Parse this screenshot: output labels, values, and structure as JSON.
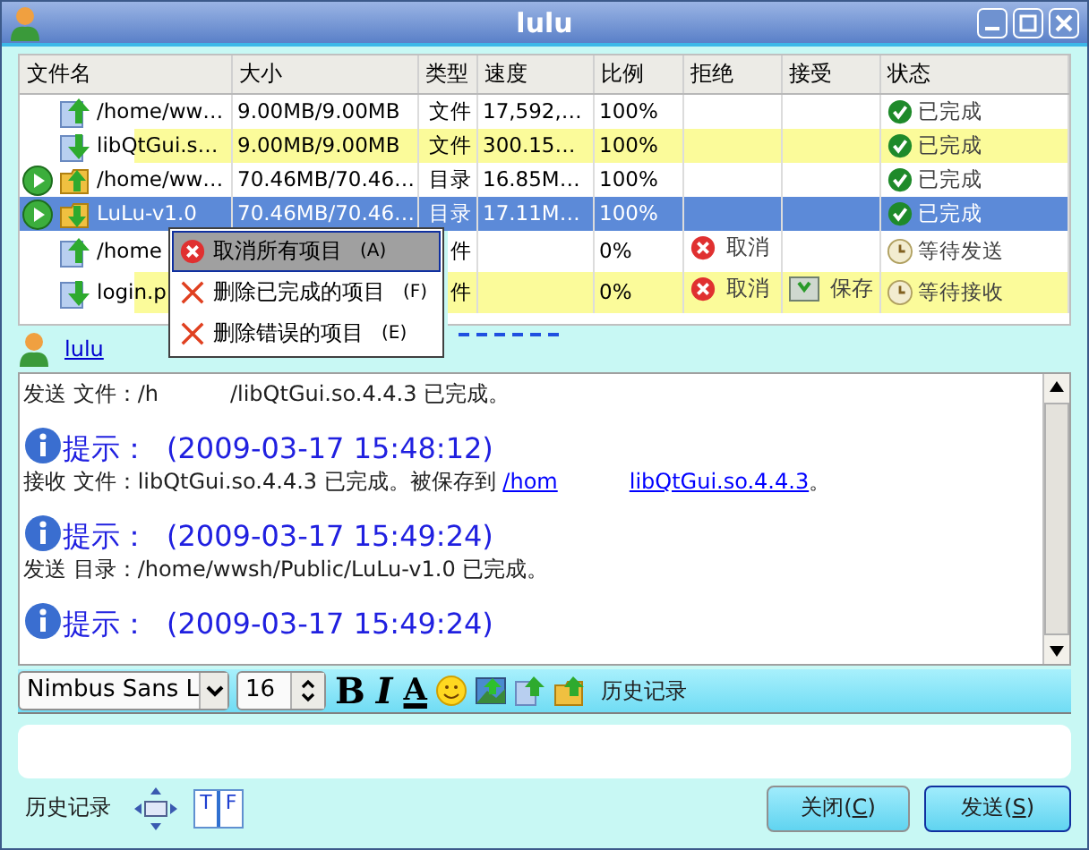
{
  "window": {
    "title": "lulu"
  },
  "table": {
    "columns": [
      "文件名",
      "大小",
      "类型",
      "速度",
      "比例",
      "拒绝",
      "接受",
      "状态"
    ],
    "rows": [
      {
        "name": "/home/ww…",
        "size": "9.00MB/9.00MB",
        "type": "文件",
        "speed": "17,592,…",
        "ratio": "100%",
        "incoming": false,
        "folder": false,
        "play_button": false,
        "reject": "",
        "accept": "",
        "status": "已完成",
        "done": true,
        "selected": false
      },
      {
        "name": "libQtGui.s…",
        "size": "9.00MB/9.00MB",
        "type": "文件",
        "speed": "300.15…",
        "ratio": "100%",
        "incoming": true,
        "folder": false,
        "play_button": false,
        "reject": "",
        "accept": "",
        "status": "已完成",
        "done": true,
        "selected": false
      },
      {
        "name": "/home/ww…",
        "size": "70.46MB/70.46…",
        "type": "目录",
        "speed": "16.85M…",
        "ratio": "100%",
        "incoming": false,
        "folder": true,
        "play_button": true,
        "reject": "",
        "accept": "",
        "status": "已完成",
        "done": true,
        "selected": false
      },
      {
        "name": "LuLu-v1.0",
        "size": "70.46MB/70.46…",
        "type": "目录",
        "speed": "17.11M…",
        "ratio": "100%",
        "incoming": true,
        "folder": true,
        "play_button": true,
        "reject": "",
        "accept": "",
        "status": "已完成",
        "done": true,
        "selected": true
      },
      {
        "name": "/home",
        "size": "",
        "type": "件",
        "speed": "",
        "ratio": "0%",
        "incoming": false,
        "folder": false,
        "play_button": false,
        "reject": "取消",
        "accept": "",
        "status": "等待发送",
        "done": false,
        "selected": false
      },
      {
        "name": "login.p",
        "size": "",
        "type": "件",
        "speed": "",
        "ratio": "0%",
        "incoming": true,
        "folder": false,
        "play_button": false,
        "reject": "取消",
        "accept": "保存",
        "status": "等待接收",
        "done": false,
        "selected": false
      }
    ]
  },
  "context_menu": {
    "items": [
      {
        "label": "取消所有项目",
        "shortcut": "(A)",
        "kind": "cancel",
        "selected": true
      },
      {
        "label": "删除已完成的项目",
        "shortcut": "(F)",
        "kind": "delete",
        "selected": false
      },
      {
        "label": "删除错误的项目",
        "shortcut": "(E)",
        "kind": "delete",
        "selected": false
      }
    ]
  },
  "peer": {
    "name": "lulu"
  },
  "messages": [
    {
      "kind": "line",
      "text": "发送 文件：/h",
      "tail": "/libQtGui.so.4.4.3 已完成。"
    },
    {
      "kind": "tip",
      "label": "提示：",
      "time": "(2009-03-17 15:48:12)"
    },
    {
      "kind": "line",
      "text": "接收 文件：libQtGui.so.4.4.3 已完成。被保存到 ",
      "link": "/hom",
      "link_tail": "libQtGui.so.4.4.3",
      "tail": "。"
    },
    {
      "kind": "tip",
      "label": "提示：",
      "time": "(2009-03-17 15:49:24)"
    },
    {
      "kind": "line",
      "text": "发送 目录：/home/wwsh/Public/LuLu-v1.0 已完成。"
    },
    {
      "kind": "tip",
      "label": "提示：",
      "time": "(2009-03-17 15:49:24)"
    }
  ],
  "toolbar": {
    "font": "Nimbus Sans L",
    "size": "16",
    "bold": "B",
    "italic": "I",
    "text_color_label": "A",
    "history": "历史记录"
  },
  "bottom": {
    "history": "历史记录",
    "layout_toggle": [
      "T",
      "F"
    ],
    "buttons": [
      {
        "prefix": "关闭(",
        "key": "C",
        "suffix": ")",
        "kind": "close"
      },
      {
        "prefix": "发送(",
        "key": "S",
        "suffix": ")",
        "kind": "send"
      }
    ]
  }
}
